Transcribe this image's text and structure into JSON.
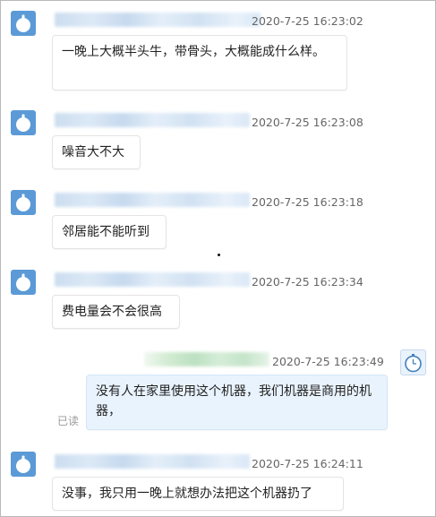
{
  "messages": [
    {
      "timestamp": "2020-7-25 16:23:02",
      "text": "一晚上大概半头牛，带骨头，大概能成什么样。"
    },
    {
      "timestamp": "2020-7-25 16:23:08",
      "text": "噪音大不大"
    },
    {
      "timestamp": "2020-7-25 16:23:18",
      "text": "邻居能不能听到"
    },
    {
      "timestamp": "2020-7-25 16:23:34",
      "text": "费电量会不会很高"
    },
    {
      "timestamp": "2020-7-25 16:23:49",
      "text": "没有人在家里使用这个机器，我们机器是商用的机器，",
      "read_label": "已读"
    },
    {
      "timestamp": "2020-7-25 16:24:11",
      "text": "没事，我只用一晚上就想办法把这个机器扔了"
    }
  ],
  "colors": {
    "avatar": "#5b9ad6",
    "own_bubble": "#e9f3fd",
    "timestamp": "#666666"
  }
}
